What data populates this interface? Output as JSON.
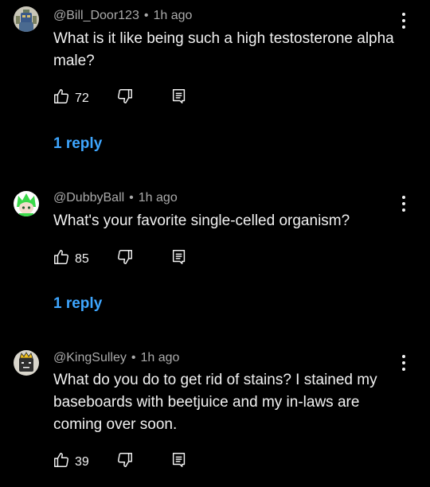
{
  "comments": [
    {
      "author": "@Bill_Door123",
      "separator": "•",
      "time": "1h ago",
      "text": "What is it like being such a high testosterone alpha male?",
      "likes": "72",
      "replies_label": "1 reply",
      "avatar_icon": "robot-avatar"
    },
    {
      "author": "@DubbyBall",
      "separator": "•",
      "time": "1h ago",
      "text": "What's your favorite single-celled organism?",
      "likes": "85",
      "replies_label": "1 reply",
      "avatar_icon": "green-character-avatar"
    },
    {
      "author": "@KingSulley",
      "separator": "•",
      "time": "1h ago",
      "text": "What do you do to get rid of stains? I stained my baseboards with beetjuice and my in-laws are coming over soon.",
      "likes": "39",
      "avatar_icon": "crowned-block-avatar"
    }
  ],
  "icons": {
    "like": "thumbs-up-icon",
    "dislike": "thumbs-down-icon",
    "reply": "reply-comment-icon",
    "menu": "more-vertical-icon"
  },
  "colors": {
    "background": "#000000",
    "text": "#f1f1f1",
    "meta": "#aaaaaa",
    "link": "#3ea6ff"
  }
}
